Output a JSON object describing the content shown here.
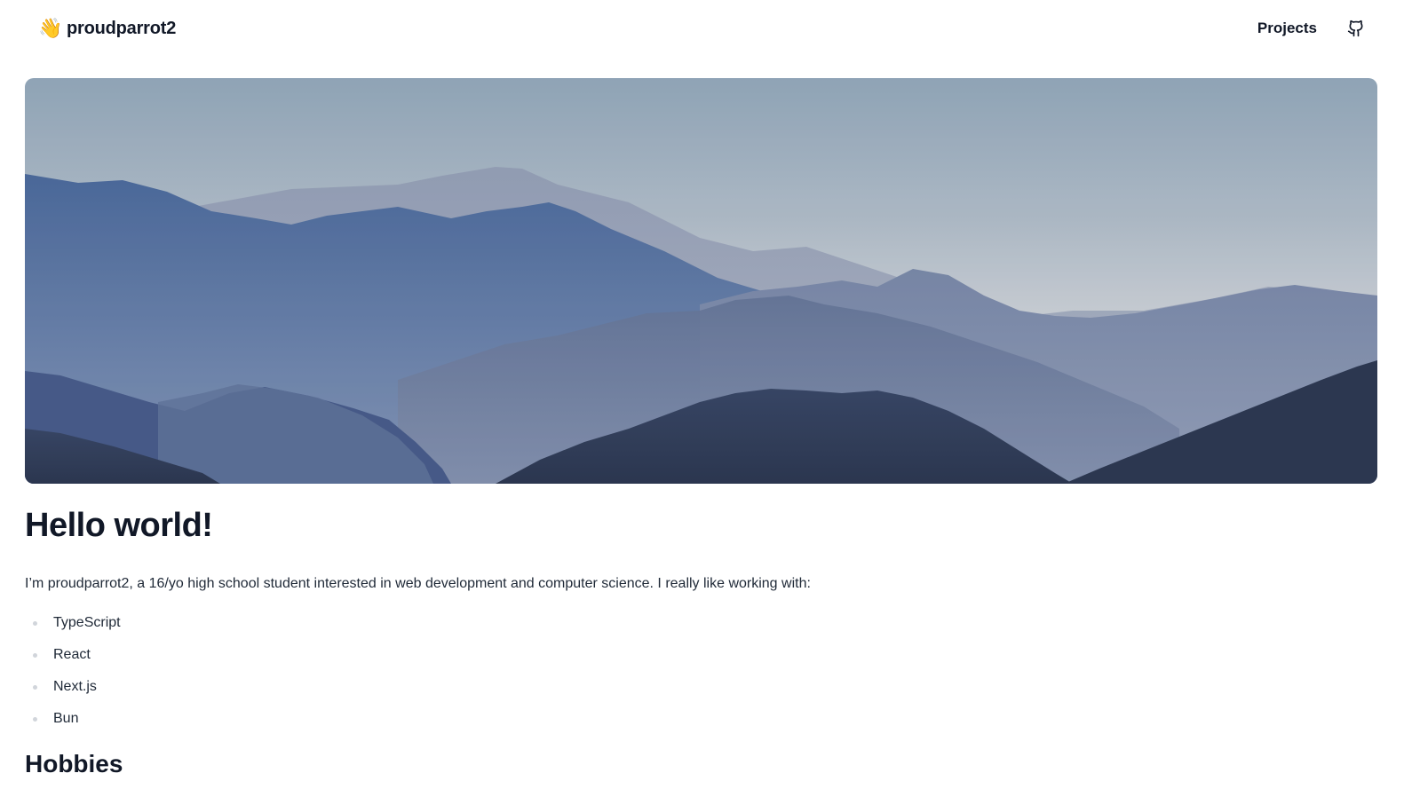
{
  "nav": {
    "brand_emoji": "👋",
    "brand_name": "proudparrot2",
    "projects_label": "Projects",
    "github_icon": "github-icon"
  },
  "hero": {
    "image_semantic": "misty blue mountain ranges landscape"
  },
  "main": {
    "title": "Hello world!",
    "intro": "I’m proudparrot2, a 16/yo high school student interested in web development and computer science. I really like working with:",
    "skills": [
      "TypeScript",
      "React",
      "Next.js",
      "Bun"
    ],
    "next_heading": "Hobbies"
  },
  "colors": {
    "text_primary": "#111827",
    "text_body": "#1f2937",
    "bullet": "#d1d5db",
    "background": "#ffffff"
  }
}
